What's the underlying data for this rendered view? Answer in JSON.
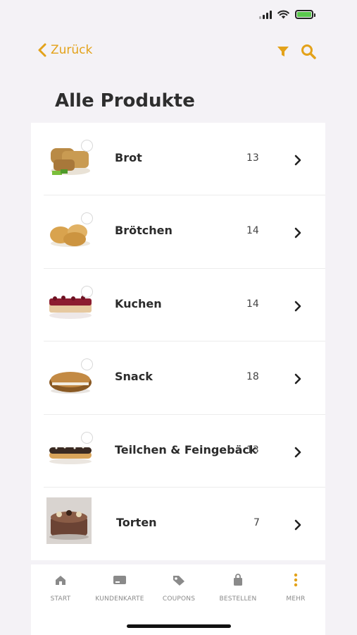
{
  "header": {
    "back_label": "Zurück",
    "title": "Alle Produkte"
  },
  "icons": {
    "back": "chevron-left-icon",
    "filter": "filter-icon",
    "search": "search-icon"
  },
  "colors": {
    "accent": "#e3a21a",
    "background": "#f4f2f6",
    "battery": "#5ac84d"
  },
  "categories": [
    {
      "label": "Brot",
      "count": "13"
    },
    {
      "label": "Brötchen",
      "count": "14"
    },
    {
      "label": "Kuchen",
      "count": "14"
    },
    {
      "label": "Snack",
      "count": "18"
    },
    {
      "label": "Teilchen & Feingebäck",
      "count": "13"
    },
    {
      "label": "Torten",
      "count": "7"
    }
  ],
  "tabbar": {
    "items": [
      {
        "label": "START",
        "icon": "home-icon"
      },
      {
        "label": "KUNDENKARTE",
        "icon": "card-icon"
      },
      {
        "label": "COUPONS",
        "icon": "tag-icon"
      },
      {
        "label": "BESTELLEN",
        "icon": "bag-icon"
      },
      {
        "label": "MEHR",
        "icon": "more-icon"
      }
    ]
  }
}
